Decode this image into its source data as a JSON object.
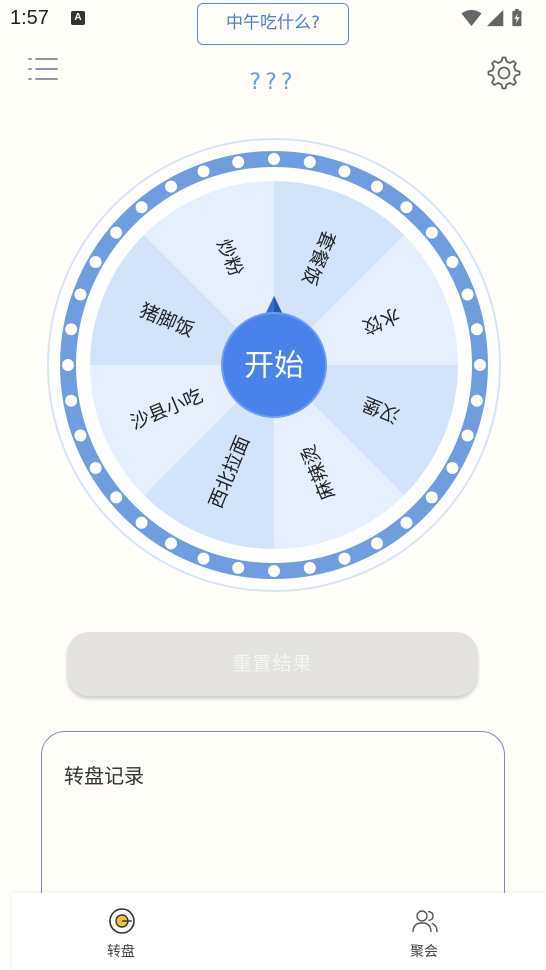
{
  "status_bar": {
    "time": "1:57",
    "notification_icon": "A"
  },
  "header": {
    "title": "中午吃什么?",
    "result": "???"
  },
  "wheel": {
    "center_label": "开始",
    "segments": [
      "套餐饭",
      "水饺",
      "汉堡",
      "麻辣烫",
      "西北拉面",
      "沙县小吃",
      "猪脚饭",
      "炒粉"
    ],
    "colors": {
      "light": "#e6effd",
      "mid": "#d3e4fa",
      "ring": "#6f9de0",
      "hub": "#4a82ec"
    }
  },
  "reset_button": {
    "label": "重置结果"
  },
  "record_card": {
    "title": "转盘记录"
  },
  "bottom_nav": {
    "items": [
      {
        "label": "转盘",
        "icon": "wheel-icon"
      },
      {
        "label": "聚会",
        "icon": "people-icon"
      }
    ]
  }
}
